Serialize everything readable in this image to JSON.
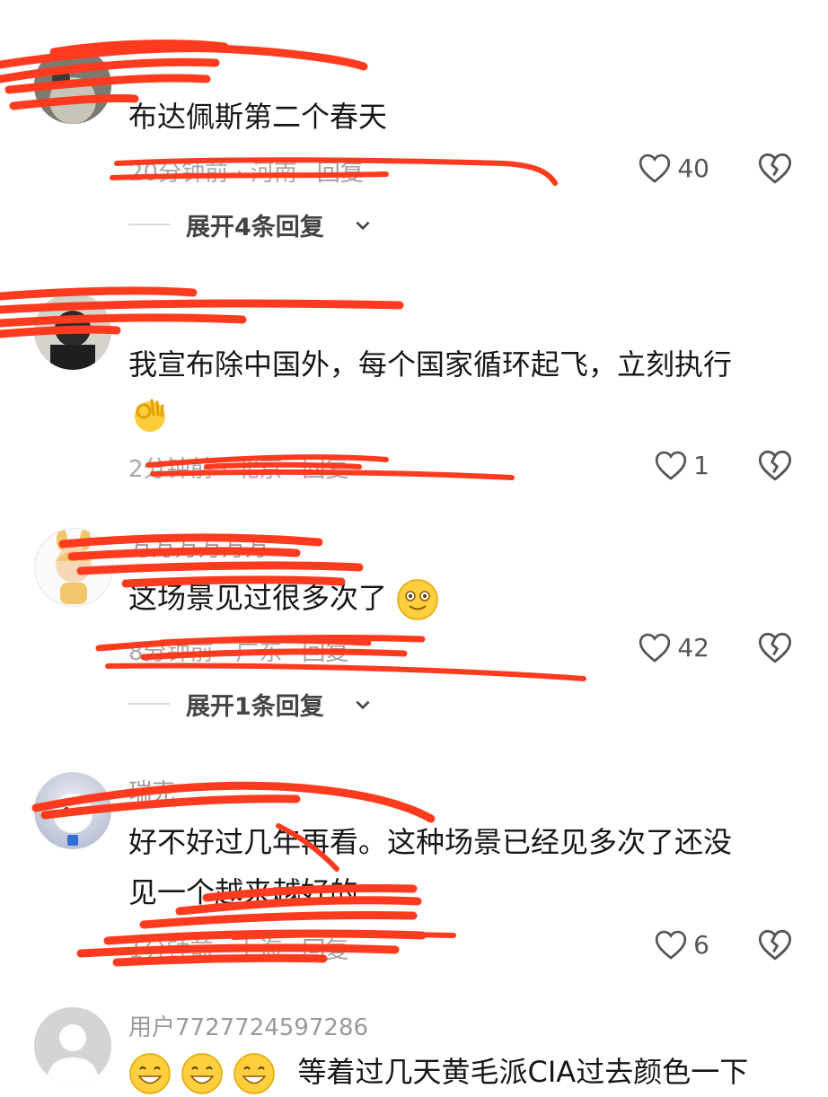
{
  "comments": [
    {
      "text": "布达佩斯第二个春天",
      "meta": "20分钟前 · 河南",
      "reply_label": "回复",
      "likes": "40",
      "expand": "展开4条回复"
    },
    {
      "text": "我宣布除中国外，每个国家循环起飞，立刻执行",
      "emoji": "ok-hand-icon",
      "meta": "2分钟前 · 北京",
      "reply_label": "回复",
      "likes": "1"
    },
    {
      "username": "万万万万万万",
      "text": "这场景见过很多次了",
      "emoji": "smiling-face-icon",
      "meta": "8分钟前 · 广东",
      "reply_label": "回复",
      "likes": "42",
      "expand": "展开1条回复"
    },
    {
      "username": "瑞克",
      "text_line1": "好不好过几年再看。这种场景已经见多次了还没",
      "text_line2": "见一个越来越好的",
      "meta": "1分钟前 · 上海",
      "reply_label": "回复",
      "likes": "6"
    },
    {
      "username": "用户7727724597286",
      "text": "等着过几天黄毛派CIA过去颜色一下"
    }
  ],
  "colors": {
    "scribble": "#ff3b1f",
    "text": "#161616",
    "meta": "#a8a8a8"
  }
}
